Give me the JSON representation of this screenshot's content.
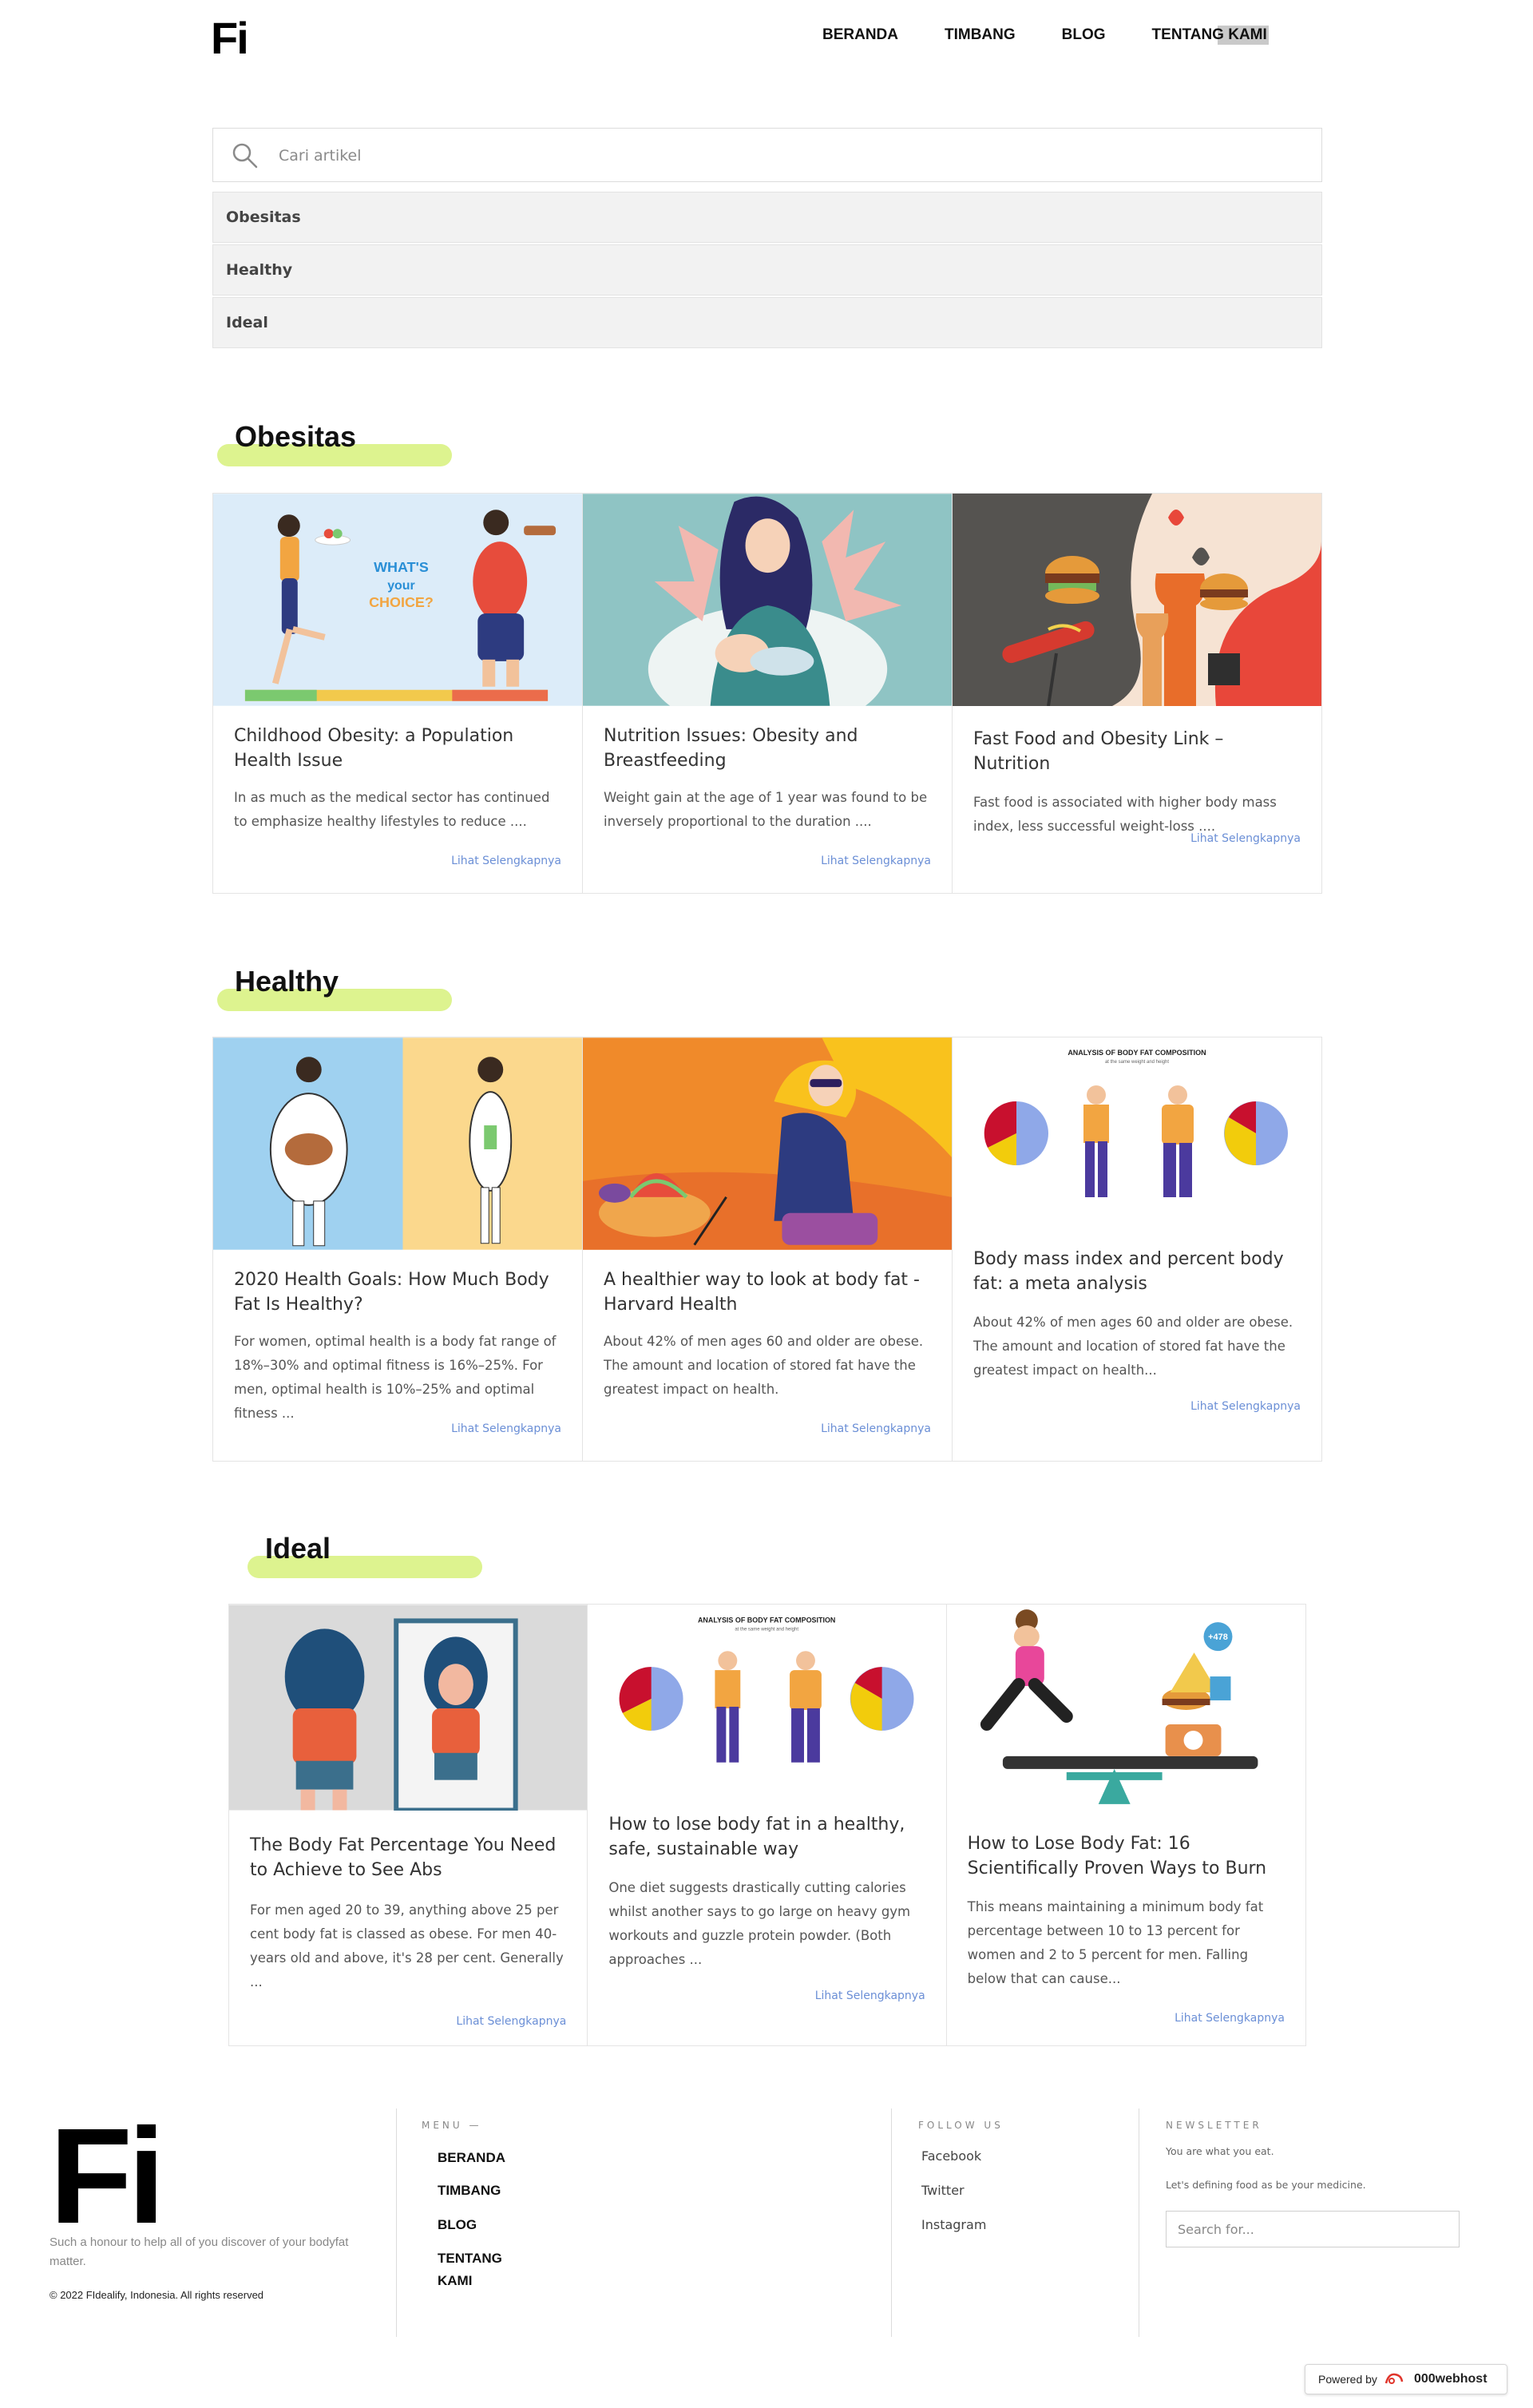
{
  "header": {
    "logo": "Fi",
    "nav": [
      "BERANDA",
      "TIMBANG",
      "BLOG",
      "TENTANG KAMI"
    ]
  },
  "search": {
    "placeholder": "Cari artikel"
  },
  "categories": [
    "Obesitas",
    "Healthy",
    "Ideal"
  ],
  "sections": [
    {
      "title": "Obesitas",
      "cards": [
        {
          "title": "Childhood Obesity: a Population Health Issue",
          "desc": "In as much as the medical sector has continued to emphasize healthy lifestyles to reduce ....",
          "more": "Lihat Selengkapnya"
        },
        {
          "title": "Nutrition Issues: Obesity and Breastfeeding",
          "desc": "Weight gain at the age of 1 year was found to be inversely proportional to the duration ....",
          "more": "Lihat Selengkapnya"
        },
        {
          "title": "Fast Food and Obesity Link – Nutrition",
          "desc": "Fast food is associated with higher body mass index, less successful weight-loss ....",
          "more": "Lihat Selengkapnya"
        }
      ]
    },
    {
      "title": "Healthy",
      "cards": [
        {
          "title": "2020 Health Goals: How Much Body Fat Is Healthy?",
          "desc": "For women, optimal health is a body fat range of 18%–30% and optimal fitness is 16%–25%. For men, optimal health is 10%–25% and optimal fitness ...",
          "more": "Lihat Selengkapnya"
        },
        {
          "title": "A healthier way to look at body fat - Harvard Health",
          "desc": "About 42% of men ages 60 and older are obese. The amount and location of stored fat have the greatest impact on health.",
          "more": "Lihat Selengkapnya"
        },
        {
          "title": "Body mass index and percent body fat: a meta analysis",
          "desc": "About 42% of men ages 60 and older are obese. The amount and location of stored fat have the greatest impact on health...",
          "more": "Lihat Selengkapnya",
          "img_title": "ANALYSIS OF BODY FAT COMPOSITION",
          "img_sub": "at the same weight and height"
        }
      ]
    },
    {
      "title": "Ideal",
      "cards": [
        {
          "title": "The Body Fat Percentage You Need to Achieve to See Abs",
          "desc": "For men aged 20 to 39, anything above 25 per cent body fat is classed as obese. For men 40-years old and above, it's 28 per cent. Generally ...",
          "more": "Lihat Selengkapnya"
        },
        {
          "title": "How to lose body fat in a healthy, safe, sustainable way",
          "desc": "One diet suggests drastically cutting calories whilst another says to go large on heavy gym workouts and guzzle protein powder. (Both approaches ...",
          "more": "Lihat Selengkapnya",
          "img_title": "ANALYSIS OF BODY FAT COMPOSITION",
          "img_sub": "at the same weight and height"
        },
        {
          "title": "How to Lose Body Fat: 16 Scientifically Proven Ways to Burn",
          "desc": "This means maintaining a minimum body fat percentage between 10 to 13 percent for women and 2 to 5 percent for men. Falling below that can cause...",
          "more": "Lihat Selengkapnya",
          "img_badge": "+478"
        }
      ]
    }
  ],
  "thumb_text": {
    "choice": "WHAT'S your CHOICE?"
  },
  "footer": {
    "logo": "Fi",
    "tagline": "Such a honour to help all of you discover of your bodyfat matter.",
    "copyright": "© 2022 FIdealify, Indonesia. All rights reserved",
    "menu_heading": "MENU —",
    "menu": [
      "BERANDA",
      "TIMBANG",
      "BLOG",
      "TENTANG KAMI"
    ],
    "follow_heading": "FOLLOW US",
    "follow": [
      "Facebook",
      "Twitter",
      "Instagram"
    ],
    "newsletter_heading": "NEWSLETTER",
    "newsletter_line1": "You are what you eat.",
    "newsletter_line2": "Let's defining food as be your medicine.",
    "newsletter_placeholder": "Search for..."
  },
  "badge": {
    "powered": "Powered by",
    "brand": "000webhost"
  }
}
